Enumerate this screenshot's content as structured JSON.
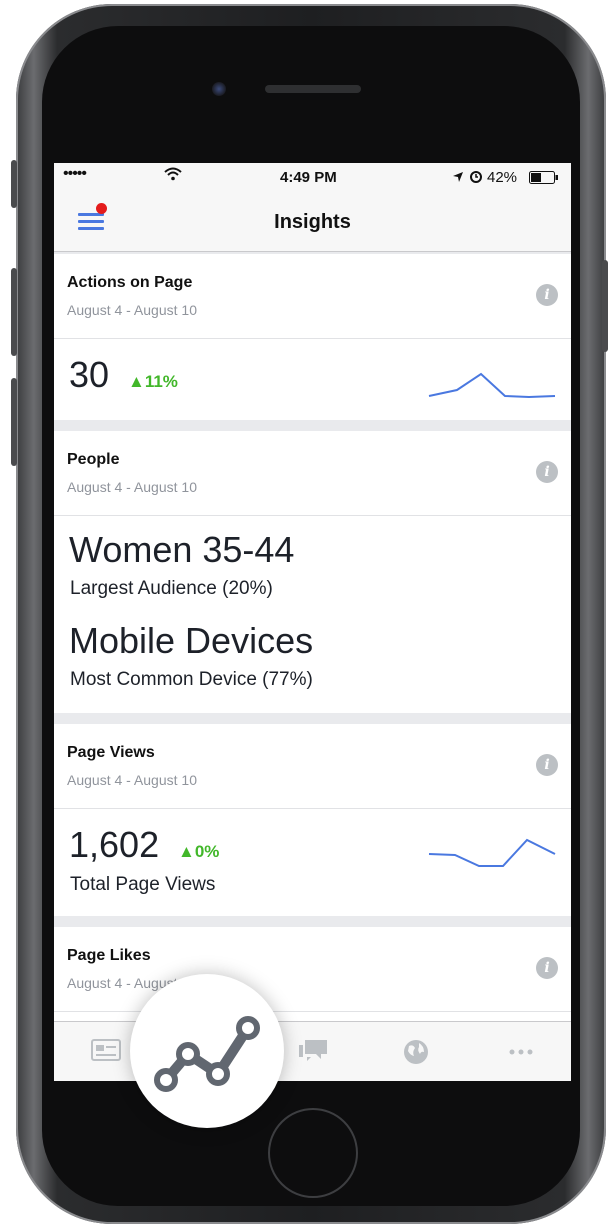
{
  "status_bar": {
    "signal": "•••••",
    "time": "4:49 PM",
    "battery": "42%"
  },
  "nav": {
    "title": "Insights"
  },
  "cards": [
    {
      "title": "Actions on Page",
      "range": "August 4 - August 10",
      "value": "30",
      "delta": "▲11%"
    },
    {
      "title": "People",
      "range": "August 4 - August 10",
      "audience": "Women 35-44",
      "audience_sub": "Largest Audience (20%)",
      "device": "Mobile Devices",
      "device_sub": "Most Common Device (77%)"
    },
    {
      "title": "Page Views",
      "range": "August 4 - August 10",
      "value": "1,602",
      "delta": "▲0%",
      "sub": "Total Page Views"
    },
    {
      "title": "Page Likes",
      "range": "August 4 - August 10"
    }
  ],
  "icons": {
    "menu": "menu-icon",
    "info": "info-icon",
    "tabs": [
      "news-feed-icon",
      "insights-icon",
      "messages-icon",
      "globe-icon",
      "more-icon"
    ],
    "fab": "insights-chart-icon"
  },
  "colors": {
    "accent_blue": "#4a78e0",
    "positive_green": "#42b72a",
    "notification_red": "#e41c1c",
    "sparkline": "#4a78e0"
  }
}
